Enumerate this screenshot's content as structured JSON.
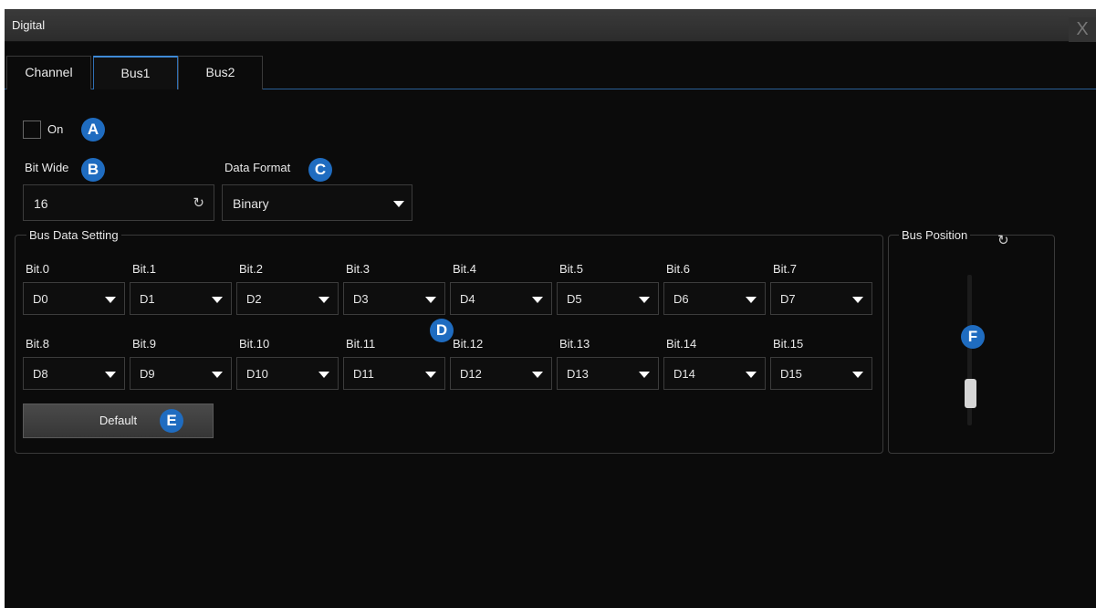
{
  "window": {
    "title": "Digital",
    "close_glyph": "X"
  },
  "tabs": [
    {
      "label": "Channel"
    },
    {
      "label": "Bus1"
    },
    {
      "label": "Bus2"
    }
  ],
  "active_tab": "Bus1",
  "on_toggle": {
    "label": "On",
    "checked": false
  },
  "bit_wide": {
    "label": "Bit Wide",
    "value": "16"
  },
  "data_format": {
    "label": "Data Format",
    "value": "Binary"
  },
  "bus_data_setting": {
    "label": "Bus Data Setting",
    "bits": [
      {
        "label": "Bit.0",
        "value": "D0"
      },
      {
        "label": "Bit.1",
        "value": "D1"
      },
      {
        "label": "Bit.2",
        "value": "D2"
      },
      {
        "label": "Bit.3",
        "value": "D3"
      },
      {
        "label": "Bit.4",
        "value": "D4"
      },
      {
        "label": "Bit.5",
        "value": "D5"
      },
      {
        "label": "Bit.6",
        "value": "D6"
      },
      {
        "label": "Bit.7",
        "value": "D7"
      },
      {
        "label": "Bit.8",
        "value": "D8"
      },
      {
        "label": "Bit.9",
        "value": "D9"
      },
      {
        "label": "Bit.10",
        "value": "D10"
      },
      {
        "label": "Bit.11",
        "value": "D11"
      },
      {
        "label": "Bit.12",
        "value": "D12"
      },
      {
        "label": "Bit.13",
        "value": "D13"
      },
      {
        "label": "Bit.14",
        "value": "D14"
      },
      {
        "label": "Bit.15",
        "value": "D15"
      }
    ],
    "default_button": "Default"
  },
  "bus_position": {
    "label": "Bus Position"
  },
  "callouts": [
    "A",
    "B",
    "C",
    "D",
    "E",
    "F"
  ],
  "colors": {
    "accent": "#2f6fb4",
    "callout": "#1f6cc0",
    "background": "#0b0b0b"
  },
  "icons": {
    "reset": "reset-icon",
    "dropdown": "chevron-down-icon",
    "close": "close-icon"
  }
}
